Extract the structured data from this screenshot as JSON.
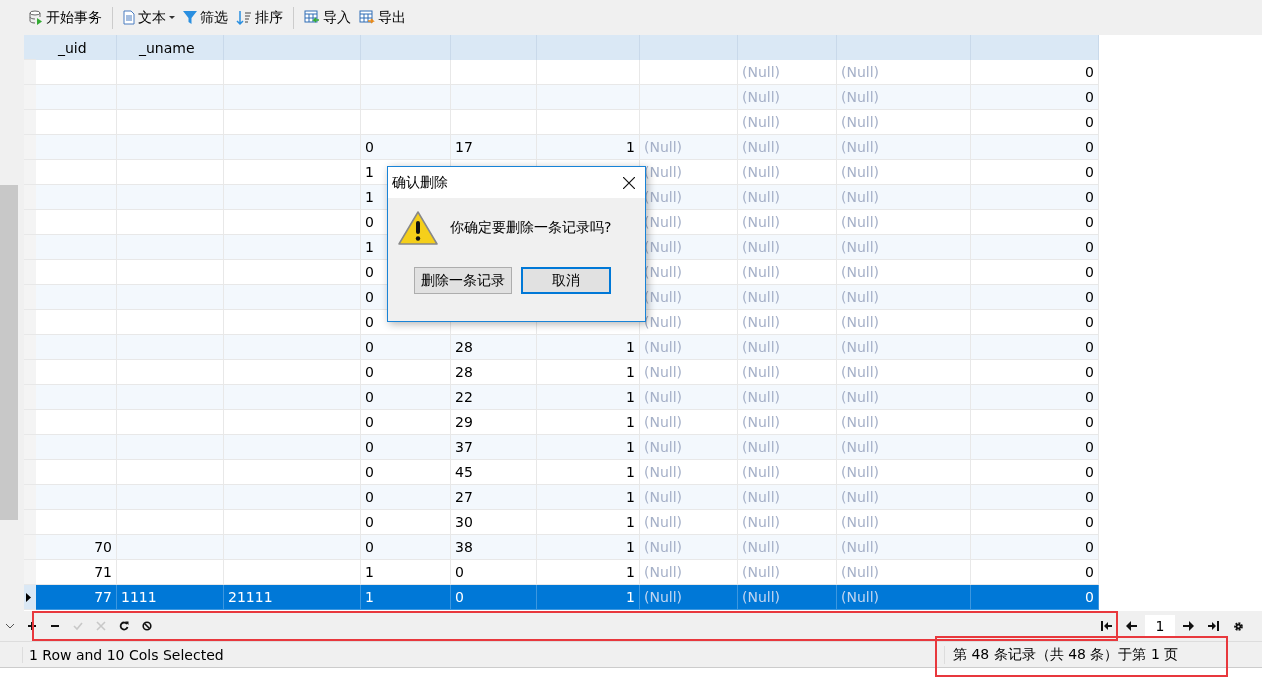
{
  "toolbar": [
    {
      "kind": "transaction",
      "label": "开始事务"
    },
    {
      "kind": "text",
      "label": "文本",
      "dropdown": true
    },
    {
      "kind": "filter",
      "label": "筛选"
    },
    {
      "kind": "sort",
      "label": "排序"
    },
    {
      "kind": "import",
      "label": "导入"
    },
    {
      "kind": "export",
      "label": "导出"
    }
  ],
  "table": {
    "columns": [
      {
        "label": "_uid",
        "kind": "number"
      },
      {
        "label": "_uname",
        "kind": "text"
      },
      {
        "kind": "text"
      },
      {
        "kind": "text"
      },
      {
        "kind": "text"
      },
      {
        "kind": "number"
      },
      {
        "kind": "text"
      },
      {
        "kind": "text"
      },
      {
        "kind": "text"
      },
      {
        "kind": "number"
      }
    ],
    "rows": [
      {
        "selected": false,
        "cells": [
          null,
          null,
          null,
          null,
          null,
          null,
          null,
          {
            "t": "(Null)",
            "null": true
          },
          {
            "t": "(Null)",
            "null": true
          },
          "0"
        ]
      },
      {
        "selected": false,
        "cells": [
          null,
          null,
          null,
          null,
          null,
          null,
          null,
          {
            "t": "(Null)",
            "null": true
          },
          {
            "t": "(Null)",
            "null": true
          },
          "0"
        ]
      },
      {
        "selected": false,
        "cells": [
          null,
          null,
          null,
          null,
          null,
          null,
          null,
          {
            "t": "(Null)",
            "null": true
          },
          {
            "t": "(Null)",
            "null": true
          },
          "0"
        ]
      },
      {
        "selected": false,
        "cells": [
          null,
          null,
          null,
          "0",
          "17",
          "1",
          {
            "t": "(Null)",
            "null": true
          },
          {
            "t": "(Null)",
            "null": true
          },
          {
            "t": "(Null)",
            "null": true
          },
          "0"
        ]
      },
      {
        "selected": false,
        "cells": [
          null,
          null,
          null,
          "1",
          null,
          null,
          {
            "t": "(Null)",
            "null": true
          },
          {
            "t": "(Null)",
            "null": true
          },
          {
            "t": "(Null)",
            "null": true
          },
          "0"
        ]
      },
      {
        "selected": false,
        "cells": [
          null,
          null,
          null,
          "1",
          null,
          null,
          {
            "t": "(Null)",
            "null": true
          },
          {
            "t": "(Null)",
            "null": true
          },
          {
            "t": "(Null)",
            "null": true
          },
          "0"
        ]
      },
      {
        "selected": false,
        "cells": [
          null,
          null,
          null,
          "0",
          null,
          null,
          {
            "t": "(Null)",
            "null": true
          },
          {
            "t": "(Null)",
            "null": true
          },
          {
            "t": "(Null)",
            "null": true
          },
          "0"
        ]
      },
      {
        "selected": false,
        "cells": [
          null,
          null,
          null,
          "1",
          null,
          null,
          {
            "t": "(Null)",
            "null": true
          },
          {
            "t": "(Null)",
            "null": true
          },
          {
            "t": "(Null)",
            "null": true
          },
          "0"
        ]
      },
      {
        "selected": false,
        "cells": [
          null,
          null,
          null,
          "0",
          null,
          null,
          {
            "t": "(Null)",
            "null": true
          },
          {
            "t": "(Null)",
            "null": true
          },
          {
            "t": "(Null)",
            "null": true
          },
          "0"
        ]
      },
      {
        "selected": false,
        "cells": [
          null,
          null,
          null,
          "0",
          null,
          null,
          {
            "t": "(Null)",
            "null": true
          },
          {
            "t": "(Null)",
            "null": true
          },
          {
            "t": "(Null)",
            "null": true
          },
          "0"
        ]
      },
      {
        "selected": false,
        "cells": [
          null,
          null,
          null,
          "0",
          null,
          null,
          {
            "t": "(Null)",
            "null": true
          },
          {
            "t": "(Null)",
            "null": true
          },
          {
            "t": "(Null)",
            "null": true
          },
          "0"
        ]
      },
      {
        "selected": false,
        "cells": [
          null,
          null,
          null,
          "0",
          "28",
          "1",
          {
            "t": "(Null)",
            "null": true
          },
          {
            "t": "(Null)",
            "null": true
          },
          {
            "t": "(Null)",
            "null": true
          },
          "0"
        ]
      },
      {
        "selected": false,
        "cells": [
          null,
          null,
          null,
          "0",
          "28",
          "1",
          {
            "t": "(Null)",
            "null": true
          },
          {
            "t": "(Null)",
            "null": true
          },
          {
            "t": "(Null)",
            "null": true
          },
          "0"
        ]
      },
      {
        "selected": false,
        "cells": [
          null,
          null,
          null,
          "0",
          "22",
          "1",
          {
            "t": "(Null)",
            "null": true
          },
          {
            "t": "(Null)",
            "null": true
          },
          {
            "t": "(Null)",
            "null": true
          },
          "0"
        ]
      },
      {
        "selected": false,
        "cells": [
          null,
          null,
          null,
          "0",
          "29",
          "1",
          {
            "t": "(Null)",
            "null": true
          },
          {
            "t": "(Null)",
            "null": true
          },
          {
            "t": "(Null)",
            "null": true
          },
          "0"
        ]
      },
      {
        "selected": false,
        "cells": [
          null,
          null,
          null,
          "0",
          "37",
          "1",
          {
            "t": "(Null)",
            "null": true
          },
          {
            "t": "(Null)",
            "null": true
          },
          {
            "t": "(Null)",
            "null": true
          },
          "0"
        ]
      },
      {
        "selected": false,
        "cells": [
          null,
          null,
          null,
          "0",
          "45",
          "1",
          {
            "t": "(Null)",
            "null": true
          },
          {
            "t": "(Null)",
            "null": true
          },
          {
            "t": "(Null)",
            "null": true
          },
          "0"
        ]
      },
      {
        "selected": false,
        "cells": [
          null,
          null,
          null,
          "0",
          "27",
          "1",
          {
            "t": "(Null)",
            "null": true
          },
          {
            "t": "(Null)",
            "null": true
          },
          {
            "t": "(Null)",
            "null": true
          },
          "0"
        ]
      },
      {
        "selected": false,
        "cells": [
          null,
          null,
          null,
          "0",
          "30",
          "1",
          {
            "t": "(Null)",
            "null": true
          },
          {
            "t": "(Null)",
            "null": true
          },
          {
            "t": "(Null)",
            "null": true
          },
          "0"
        ]
      },
      {
        "selected": false,
        "cells": [
          "70",
          null,
          null,
          "0",
          "38",
          "1",
          {
            "t": "(Null)",
            "null": true
          },
          {
            "t": "(Null)",
            "null": true
          },
          {
            "t": "(Null)",
            "null": true
          },
          "0"
        ]
      },
      {
        "selected": false,
        "cells": [
          "71",
          null,
          null,
          "1",
          "0",
          "1",
          {
            "t": "(Null)",
            "null": true
          },
          {
            "t": "(Null)",
            "null": true
          },
          {
            "t": "(Null)",
            "null": true
          },
          "0"
        ]
      },
      {
        "selected": true,
        "cells": [
          "77",
          "1111",
          "21111",
          "1",
          "0",
          "1",
          {
            "t": "(Null)",
            "null": true
          },
          {
            "t": "(Null)",
            "null": true
          },
          {
            "t": "(Null)",
            "null": true
          },
          "0"
        ]
      }
    ]
  },
  "dialog": {
    "title": "确认删除",
    "message": "你确定要删除一条记录吗?",
    "buttons": [
      {
        "label": "删除一条记录",
        "selected": false
      },
      {
        "label": "取消",
        "selected": true
      }
    ]
  },
  "record_toolbar": [
    {
      "kind": "add",
      "disabled": false
    },
    {
      "kind": "remove",
      "disabled": false
    },
    {
      "kind": "apply",
      "disabled": true
    },
    {
      "kind": "discard",
      "disabled": true
    },
    {
      "kind": "refresh",
      "disabled": false
    },
    {
      "kind": "stop",
      "disabled": false
    }
  ],
  "pager": {
    "page": "1"
  },
  "status_bar": {
    "selection": "1 Row and 10 Cols Selected",
    "records": "第 48 条记录（共 48 条）于第 1 页"
  }
}
